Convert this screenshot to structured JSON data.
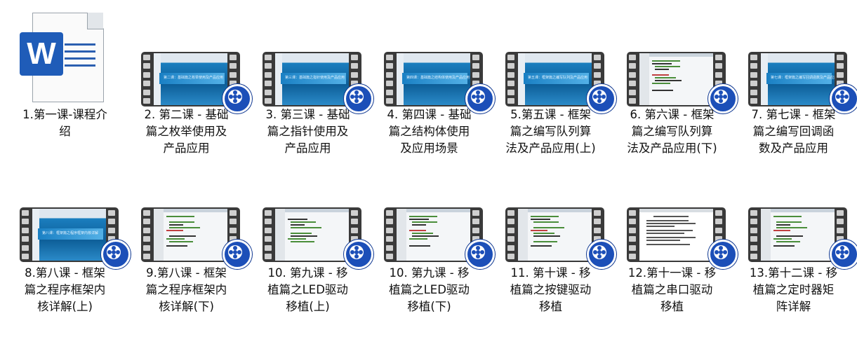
{
  "files": [
    {
      "label_lines": [
        "1.第一课-课程介",
        "绍"
      ],
      "type": "word"
    },
    {
      "label_lines": [
        "2. 第二课 - 基础",
        "篇之枚举使用及",
        "产品应用"
      ],
      "type": "video",
      "screen": "blue",
      "slide_text": "第二课：基础篇之枚举使用及产品应用"
    },
    {
      "label_lines": [
        "3. 第三课 - 基础",
        "篇之指针使用及",
        "产品应用"
      ],
      "type": "video",
      "screen": "blue",
      "slide_text": "第三课：基础篇之指针使用及产品应用"
    },
    {
      "label_lines": [
        "4. 第四课 - 基础",
        "篇之结构体使用",
        "及应用场景"
      ],
      "type": "video",
      "screen": "blue",
      "slide_text": "第四课：基础篇之结构体使用及产品应用"
    },
    {
      "label_lines": [
        "5.第五课 - 框架",
        "篇之编写队列算",
        "法及产品应用(上)"
      ],
      "type": "video",
      "screen": "blue",
      "slide_text": "第五课：框架篇之编写队列及产品应用"
    },
    {
      "label_lines": [
        "6. 第六课 - 框架",
        "篇之编写队列算",
        "法及产品应用(下)"
      ],
      "type": "video",
      "screen": "code"
    },
    {
      "label_lines": [
        "7. 第七课 - 框架",
        "篇之编写回调函",
        "数及产品应用"
      ],
      "type": "video",
      "screen": "blue",
      "slide_text": "第七课：框架篇之编写回调函数及产品应用"
    },
    {
      "label_lines": [
        "8.第八课 - 框架",
        "篇之程序框架内",
        "核详解(上)"
      ],
      "type": "video",
      "screen": "blue",
      "slide_text": "第八课：框架篇之程序框架内核详解"
    },
    {
      "label_lines": [
        "9.第八课 - 框架",
        "篇之程序框架内",
        "核详解(下)"
      ],
      "type": "video",
      "screen": "code"
    },
    {
      "label_lines": [
        "10. 第九课 - 移",
        "植篇之LED驱动",
        "移植(上)"
      ],
      "type": "video",
      "screen": "code"
    },
    {
      "label_lines": [
        "10. 第九课 - 移",
        "植篇之LED驱动",
        "移植(下)"
      ],
      "type": "video",
      "screen": "code"
    },
    {
      "label_lines": [
        "11. 第十课 - 移",
        "植篇之按键驱动",
        "移植"
      ],
      "type": "video",
      "screen": "code"
    },
    {
      "label_lines": [
        "12.第十一课 - 移",
        "植篇之串口驱动",
        "移植"
      ],
      "type": "video",
      "screen": "doc"
    },
    {
      "label_lines": [
        "13.第十二课 - 移",
        "植篇之定时器矩",
        "阵详解"
      ],
      "type": "video",
      "screen": "code"
    }
  ],
  "icons": {
    "video": "video-file-icon",
    "word": "word-document-icon",
    "play": "video-player-badge-icon"
  },
  "colors": {
    "film": "#3a3a3a",
    "slide_blue": "#1b7fc0",
    "word_blue": "#1f5cb8",
    "badge": "#1c4fb8"
  }
}
